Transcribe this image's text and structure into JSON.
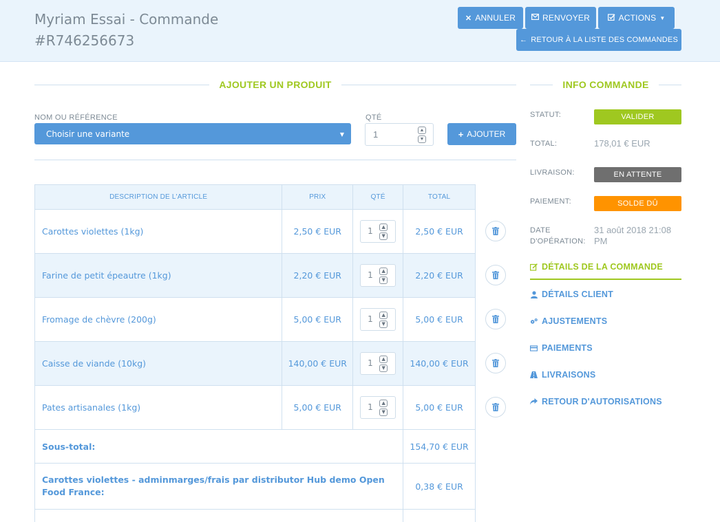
{
  "header": {
    "title_line1": "Myriam Essai - Commande",
    "title_line2": "#R746256673",
    "buttons": {
      "cancel": "ANNULER",
      "resend": "RENVOYER",
      "actions": "ACTIONS",
      "back": "RETOUR À LA LISTE DES COMMANDES"
    }
  },
  "add_product": {
    "section_title": "AJOUTER UN PRODUIT",
    "name_label": "NOM OU RÉFÉRENCE",
    "select_value": "Choisir une variante",
    "qty_label": "QTÉ",
    "qty_value": "1",
    "add_button": "AJOUTER"
  },
  "table": {
    "headers": [
      "DESCRIPTION DE L'ARTICLE",
      "PRIX",
      "QTÉ",
      "TOTAL"
    ],
    "rows": [
      {
        "description": "Carottes violettes (1kg)",
        "price": "2,50 € EUR",
        "qty": "1",
        "total": "2,50 € EUR"
      },
      {
        "description": "Farine de petit épeautre (1kg)",
        "price": "2,20 € EUR",
        "qty": "1",
        "total": "2,20 € EUR"
      },
      {
        "description": "Fromage de chèvre (200g)",
        "price": "5,00 € EUR",
        "qty": "1",
        "total": "5,00 € EUR"
      },
      {
        "description": "Caisse de viande (10kg)",
        "price": "140,00 € EUR",
        "qty": "1",
        "total": "140,00 € EUR"
      },
      {
        "description": "Pates artisanales (1kg)",
        "price": "5,00 € EUR",
        "qty": "1",
        "total": "5,00 € EUR"
      }
    ],
    "subtotal_label": "Sous-total:",
    "subtotal_value": "154,70 € EUR",
    "fee_label": "Carottes violettes - adminmarges/frais par distributor Hub demo Open Food France:",
    "fee_value": "0,38 € EUR"
  },
  "info": {
    "section_title": "INFO COMMANDE",
    "status_label": "STATUT:",
    "status_value": "VALIDER",
    "total_label": "TOTAL:",
    "total_value": "178,01 € EUR",
    "shipping_label": "LIVRAISON:",
    "shipping_value": "EN ATTENTE",
    "payment_label": "PAIEMENT:",
    "payment_value": "SOLDE DÛ",
    "date_label_1": "DATE",
    "date_label_2": "D'OPÉRATION:",
    "date_value_1": "31 août 2018 21:08",
    "date_value_2": "PM"
  },
  "nav": [
    {
      "label": "DÉTAILS DE LA COMMANDE",
      "icon": "edit-icon"
    },
    {
      "label": "DÉTAILS CLIENT",
      "icon": "user-icon"
    },
    {
      "label": "AJUSTEMENTS",
      "icon": "cogs-icon"
    },
    {
      "label": "PAIEMENTS",
      "icon": "credit-card-icon"
    },
    {
      "label": "LIVRAISONS",
      "icon": "road-icon"
    },
    {
      "label": "RETOUR D'AUTORISATIONS",
      "icon": "share-icon"
    }
  ],
  "colors": {
    "primary": "#5498da",
    "green": "#9fc820",
    "gray_badge": "#6f6f6f",
    "orange_badge": "#ff9300",
    "header_bg": "#eaf4fc"
  }
}
